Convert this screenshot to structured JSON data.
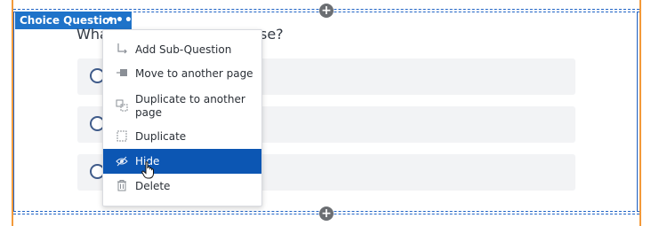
{
  "block": {
    "type_label": "Choice Question",
    "more_icon": "more-dots-icon",
    "question_start": "Wha",
    "question_end": "se?"
  },
  "options": [
    {
      "selected": false
    },
    {
      "selected": false
    },
    {
      "selected": false
    }
  ],
  "menu": {
    "items": [
      {
        "label": "Add Sub-Question",
        "icon": "sub-question-icon"
      },
      {
        "label": "Move to another page",
        "icon": "move-page-icon"
      },
      {
        "label": "Duplicate to another",
        "label2": "page",
        "icon": "duplicate-page-icon"
      },
      {
        "label": "Duplicate",
        "icon": "duplicate-icon"
      },
      {
        "label": "Hide",
        "icon": "hide-eye-icon",
        "highlighted": true
      },
      {
        "label": "Delete",
        "icon": "trash-icon"
      }
    ]
  },
  "add_buttons": {
    "symbol": "+"
  },
  "colors": {
    "accent": "#1f73c9",
    "menu_highlight": "#0c56b3",
    "orange_border": "#f39a3a",
    "option_bg": "#f2f3f5"
  }
}
